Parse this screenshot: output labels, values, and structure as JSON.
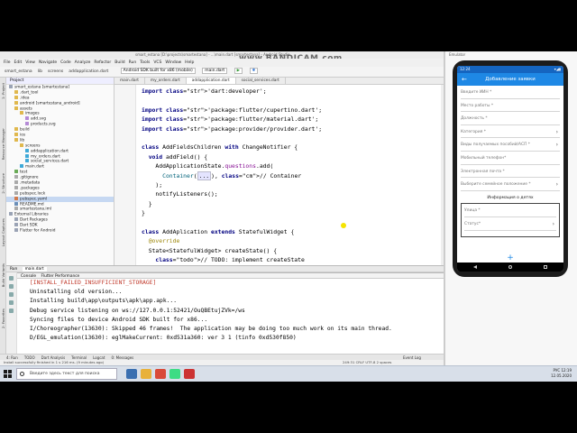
{
  "ide": {
    "title": "smart_estana [D:\\projects\\smartestana] - ...\\main.dart [smartestana] - Android Studio",
    "watermark": "www.BANDICAM.com",
    "menu": [
      "File",
      "Edit",
      "View",
      "Navigate",
      "Code",
      "Analyze",
      "Refactor",
      "Build",
      "Run",
      "Tools",
      "VCS",
      "Window",
      "Help"
    ],
    "breadcrumbs": [
      "smart_estana",
      "lib",
      "screens",
      "addapplication.dart"
    ],
    "device": "Android SDK built for x86 (mobile)",
    "run_config": "main.dart",
    "editor_tabs": [
      "main.dart",
      "my_orders.dart",
      "addapplication.dart",
      "social_services.dart"
    ],
    "active_tab_index": 2,
    "project_panel": {
      "header": "Project",
      "tree": [
        {
          "label": "smart_estana [smartestana]",
          "depth": 0,
          "color": "#9aa3b5"
        },
        {
          "label": ".dart_tool",
          "depth": 1,
          "color": "#e0b84d"
        },
        {
          "label": ".idea",
          "depth": 1,
          "color": "#e0b84d"
        },
        {
          "label": "android [smartestana_android]",
          "depth": 1,
          "color": "#e0b84d"
        },
        {
          "label": "assets",
          "depth": 1,
          "color": "#e0b84d"
        },
        {
          "label": "images",
          "depth": 2,
          "color": "#e0b84d"
        },
        {
          "label": "add.svg",
          "depth": 3,
          "color": "#b48ad6"
        },
        {
          "label": "products.svg",
          "depth": 3,
          "color": "#b48ad6"
        },
        {
          "label": "build",
          "depth": 1,
          "color": "#e0b84d"
        },
        {
          "label": "ios",
          "depth": 1,
          "color": "#e0b84d"
        },
        {
          "label": "lib",
          "depth": 1,
          "color": "#e0b84d"
        },
        {
          "label": "screens",
          "depth": 2,
          "color": "#e0b84d"
        },
        {
          "label": "addapplication.dart",
          "depth": 3,
          "color": "#3fa9d8"
        },
        {
          "label": "my_orders.dart",
          "depth": 3,
          "color": "#3fa9d8"
        },
        {
          "label": "social_services.dart",
          "depth": 3,
          "color": "#3fa9d8"
        },
        {
          "label": "main.dart",
          "depth": 2,
          "color": "#3fa9d8"
        },
        {
          "label": "test",
          "depth": 1,
          "color": "#6aab57"
        },
        {
          "label": ".gitignore",
          "depth": 1,
          "color": "#aaaaaa"
        },
        {
          "label": ".metadata",
          "depth": 1,
          "color": "#aaaaaa"
        },
        {
          "label": ".packages",
          "depth": 1,
          "color": "#aaaaaa"
        },
        {
          "label": "pubspec.lock",
          "depth": 1,
          "color": "#aaaaaa"
        },
        {
          "label": "pubspec.yaml",
          "depth": 1,
          "color": "#d07a4c",
          "selected": true
        },
        {
          "label": "README.md",
          "depth": 1,
          "color": "#6b8fb8"
        },
        {
          "label": "smartestana.iml",
          "depth": 1,
          "color": "#aaaaaa"
        },
        {
          "label": "External Libraries",
          "depth": 0,
          "color": "#9aa3b5"
        },
        {
          "label": "Dart Packages",
          "depth": 1,
          "color": "#9aa3b5"
        },
        {
          "label": "Dart SDK",
          "depth": 1,
          "color": "#9aa3b5"
        },
        {
          "label": "Flutter for Android",
          "depth": 1,
          "color": "#9aa3b5"
        }
      ]
    },
    "left_strip_labels": [
      "1: Project",
      "Resource Manager",
      "2: Structure",
      "Layout Captures",
      "Build Variants",
      "2: Favorites"
    ],
    "code": [
      "import 'dart:developer';",
      "",
      "import 'package:flutter/cupertino.dart';",
      "import 'package:flutter/material.dart';",
      "import 'package:provider/provider.dart';",
      "",
      "class AddFieldsChildren with ChangeNotifier {",
      "  void addField() {",
      "    AddApplicationState.questions.add(",
      "      Container(...), // Container",
      "    );",
      "    notifyListeners();",
      "  }",
      "}",
      "",
      "class AddAplication extends StatefulWidget {",
      "  @override",
      "  State<StatefulWidget> createState() {",
      "    // TODO: implement createState",
      "    return AddApplicationState();",
      "  }"
    ],
    "run_panel": {
      "tab_run": "Run",
      "tab_file": "main.dart",
      "console_tabs": [
        "Console",
        "Flutter Performance"
      ],
      "lines": [
        "[INSTALL_FAILED_INSUFFICIENT_STORAGE]",
        "Uninstalling old version...",
        "Installing build\\app\\outputs\\apk\\app.apk...",
        "Debug service listening on ws://127.0.0.1:52421/OuQBEtujZVk=/ws",
        "Syncing files to device Android SDK built for x86...",
        "I/Choreographer(13630): Skipped 46 frames!  The application may be doing too much work on its main thread.",
        "D/EGL_emulation(13630): eglMakeCurrent: 0xd531a360: ver 3 1 (tinfo 0xd530f850)"
      ]
    },
    "bottom_tabs": [
      "4: Run",
      "TODO",
      "Dart Analysis",
      "Terminal",
      "Logcat",
      "0: Messages",
      "Event Log"
    ],
    "status": {
      "message": "Install successfully finished in 1 s 216 ms. (9 minutes ago)",
      "position": "249:31",
      "encoding": "CRLF  UTF-8  2 spaces"
    }
  },
  "emulator": {
    "status_time": "12:24",
    "title": "Добавление заявки",
    "fields": [
      {
        "label": "Введите ИИН *",
        "chevron": false
      },
      {
        "label": "Место работы *",
        "chevron": false
      },
      {
        "label": "Должность *",
        "chevron": false
      },
      {
        "label": "Категория *",
        "chevron": true
      },
      {
        "label": "Виды получаемых пособий/АСП *",
        "chevron": true
      },
      {
        "label": "Мобильный телефон*",
        "chevron": false
      },
      {
        "label": "Электронная почта *",
        "chevron": false
      },
      {
        "label": "Выберите семейное положение *",
        "chevron": true
      }
    ],
    "children_title": "Информация о детях",
    "children_fields": [
      {
        "label": "Улица *",
        "chevron": false
      },
      {
        "label": "Статус*",
        "chevron": true
      }
    ],
    "fab": "+"
  },
  "taskbar": {
    "search_placeholder": "Введите здесь текст для поиска",
    "tray_time": "12:19",
    "tray_date": "12.05.2020",
    "tray_lang": "РУС"
  },
  "colors": {
    "appbar": "#1e88e5",
    "statusbar": "#1565c0",
    "keyword": "#000080",
    "string": "#067d17",
    "error": "#c0392b"
  }
}
